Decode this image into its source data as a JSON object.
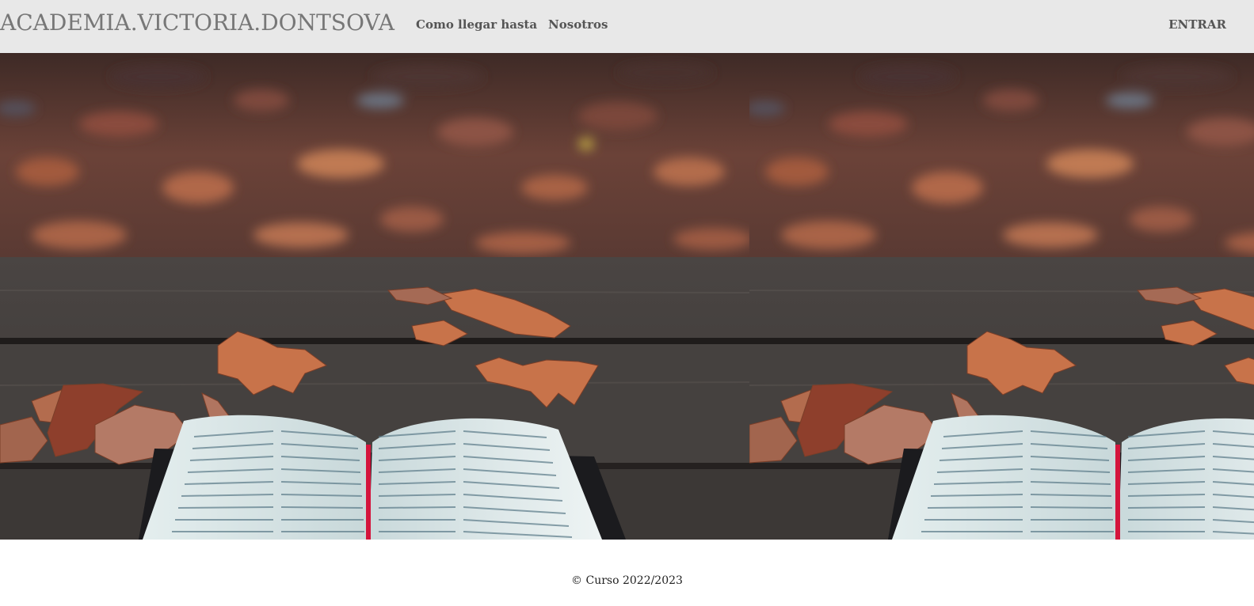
{
  "navbar": {
    "brand": "ACADEMIA.VICTORIA.DONTSOVA",
    "links": [
      {
        "label": "Como llegar hasta"
      },
      {
        "label": "Nosotros"
      }
    ],
    "login_label": "ENTRAR"
  },
  "hero": {
    "image": "autumn-leaves-and-open-bible-on-wooden-table",
    "colors": {
      "leaves_background": "#6b4238",
      "wood": "#3f3b39",
      "leaf": "#c8734a",
      "page": "#e9f1f1",
      "bookmark": "#d4143c"
    }
  },
  "footer": {
    "copyright": "© Curso 2022/2023"
  }
}
